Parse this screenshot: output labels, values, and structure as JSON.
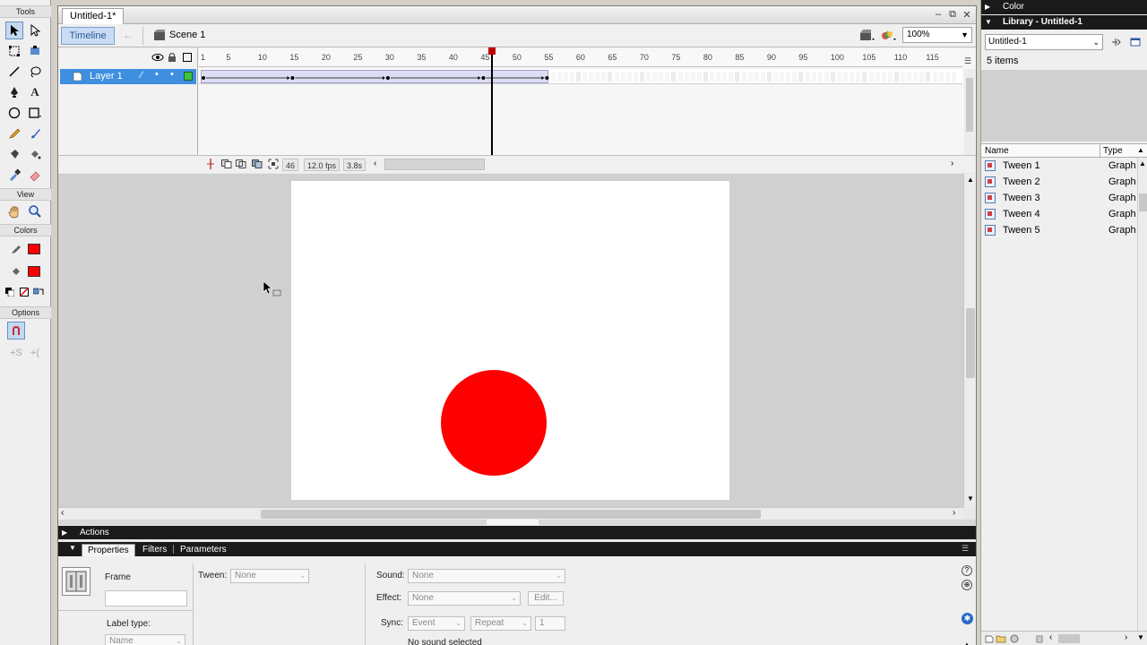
{
  "tools_panel": {
    "title": "Tools",
    "view_label": "View",
    "colors_label": "Colors",
    "options_label": "Options",
    "stroke_color": "#ff0000",
    "fill_color": "#ff0000"
  },
  "document": {
    "tab_title": "Untitled-1*",
    "timeline_button": "Timeline",
    "scene_label": "Scene 1",
    "zoom": "100%"
  },
  "timeline": {
    "ruler_ticks": [
      "1",
      "5",
      "10",
      "15",
      "20",
      "25",
      "30",
      "35",
      "40",
      "45",
      "50",
      "55",
      "60",
      "65",
      "70",
      "75",
      "80",
      "85",
      "90",
      "95",
      "100",
      "105",
      "110",
      "115"
    ],
    "layer_name": "Layer 1",
    "current_frame": "46",
    "frame_rate": "12.0 fps",
    "elapsed_time": "3.8s",
    "last_frame": 55,
    "keyframes": [
      1,
      15,
      30,
      45,
      55
    ]
  },
  "stage": {
    "ball_color": "#ff0000"
  },
  "panels": {
    "actions_label": "Actions",
    "tabs": [
      "Properties",
      "Filters",
      "Parameters"
    ]
  },
  "properties": {
    "frame_label": "Frame",
    "tween_label": "Tween:",
    "tween_value": "None",
    "sound_label": "Sound:",
    "sound_value": "None",
    "effect_label": "Effect:",
    "effect_value": "None",
    "edit_button": "Edit...",
    "sync_label": "Sync:",
    "sync_value": "Event",
    "repeat_value": "Repeat",
    "repeat_count": "1",
    "no_sound": "No sound selected",
    "label_type_label": "Label type:",
    "label_type_value": "Name"
  },
  "library": {
    "color_header": "Color",
    "header": "Library - Untitled-1",
    "doc_select": "Untitled-1",
    "count": "5 items",
    "col_name": "Name",
    "col_type": "Type",
    "items": [
      {
        "name": "Tween 1",
        "type": "Graph"
      },
      {
        "name": "Tween 2",
        "type": "Graph"
      },
      {
        "name": "Tween 3",
        "type": "Graph"
      },
      {
        "name": "Tween 4",
        "type": "Graph"
      },
      {
        "name": "Tween 5",
        "type": "Graph"
      }
    ]
  }
}
